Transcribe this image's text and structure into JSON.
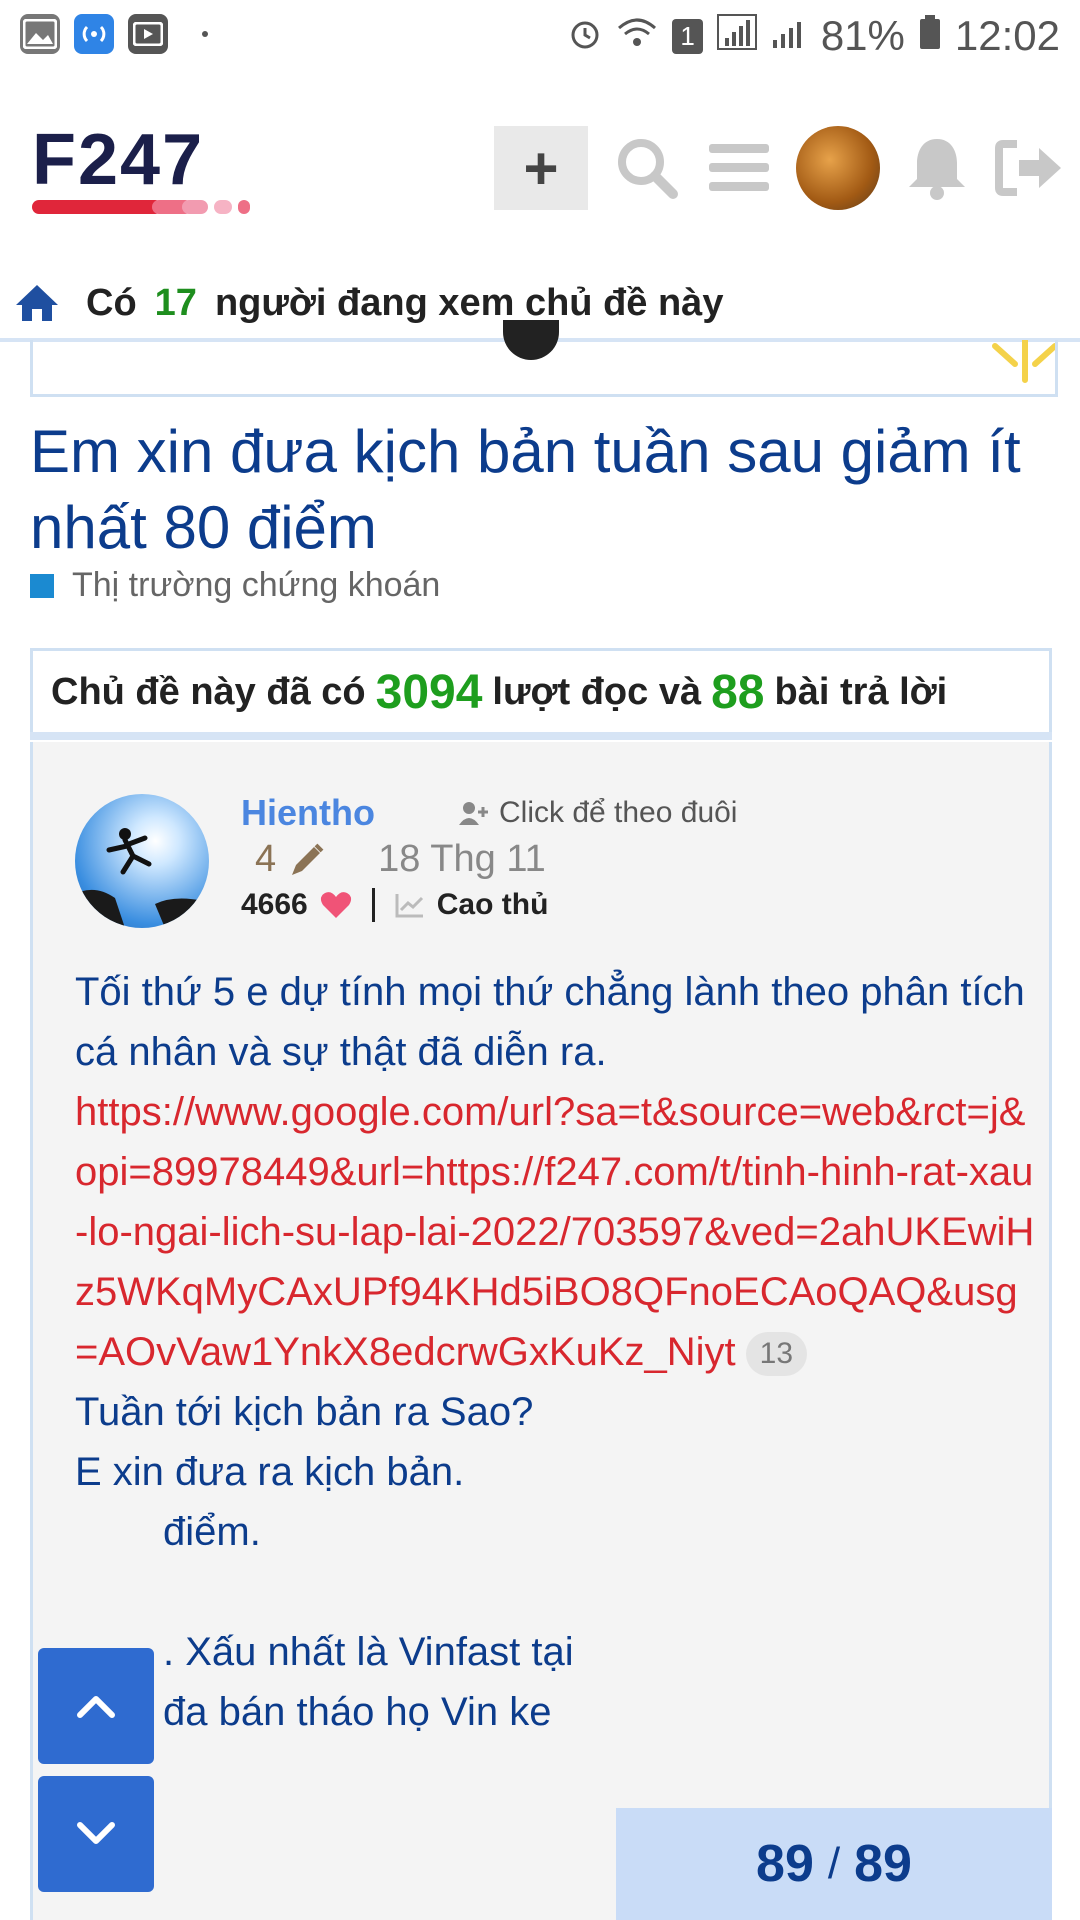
{
  "status_bar": {
    "battery": "81%",
    "time": "12:02",
    "sim_badge": "1"
  },
  "header": {
    "logo_text": "F247",
    "avatar": "tiger-avatar",
    "icons": [
      "plus-icon",
      "search-icon",
      "menu-icon",
      "bell-icon",
      "logout-icon"
    ]
  },
  "viewers": {
    "prefix": "Có",
    "count": "17",
    "suffix": "người đang xem chủ đề này"
  },
  "topic": {
    "title": "Em xin đưa kịch bản tuần sau giảm ít nhất 80 điểm",
    "category": "Thị trường chứng khoán",
    "category_color": "#1b8ad1"
  },
  "stats": {
    "prefix": "Chủ đề này đã có",
    "views": "3094",
    "mid": "lượt đọc và",
    "replies": "88",
    "suffix": "bài trả lời"
  },
  "post": {
    "author": "Hientho",
    "follow_label": "Click để theo đuôi",
    "edits": "4",
    "date": "18 Thg 11",
    "likes": "4666",
    "rank": "Cao thủ",
    "line1": "Tối thứ 5 e dự tính mọi thứ chẳng lành theo phân tích cá nhân và sự thật đã diễn ra.",
    "link": "https://www.google.com/url?sa=t&source=web&rct=j&opi=89978449&url=https://f247.com/t/tinh-hinh-rat-xau-lo-ngai-lich-su-lap-lai-2022/703597&ved=2ahUKEwiHz5WKqMyCAxUPf94KHd5iBO8QFnoECAoQAQ&usg=AOvVaw1YnkX8edcrwGxKuKz_Niyt",
    "link_clicks": "13",
    "line2": "Tuần tới kịch bản ra Sao?",
    "line3": "E xin đưa ra kịch bản.",
    "line4_partial": "điểm.",
    "line5_partial": ". Xấu nhất là Vinfast tại",
    "line6_partial": "đa bán tháo họ Vin ke"
  },
  "pager": {
    "current": "89",
    "total": "89"
  }
}
